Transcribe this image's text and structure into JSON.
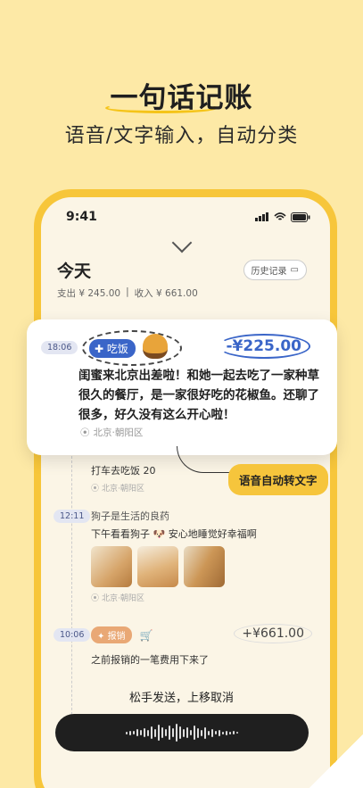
{
  "headline": {
    "title": "一句话记账",
    "subtitle": "语音/文字输入，自动分类"
  },
  "status_bar": {
    "time": "9:41"
  },
  "page": {
    "title": "今天",
    "history_button": "历史记录"
  },
  "totals": {
    "expense": "支出 ¥ 245.00",
    "separator": "|",
    "income": "收入 ¥ 661.00"
  },
  "card": {
    "time": "18:06",
    "tag": "吃饭",
    "amount": "-¥225.00",
    "text": "闺蜜来北京出差啦！和她一起去吃了一家种草很久的餐厅，是一家很好吃的花椒鱼。还聊了很多，好久没有这么开心啦！",
    "location": "北京·朝阳区"
  },
  "voice_tip": "语音自动转文字",
  "entries": [
    {
      "desc": "打车去吃饭 20",
      "location": "北京·朝阳区"
    },
    {
      "time": "12:11",
      "title": "狗子是生活的良药",
      "desc": "下午看看狗子 🐶 安心地睡觉好幸福啊",
      "location": "北京·朝阳区"
    },
    {
      "time": "10:06",
      "tag": "报销",
      "amount": "+¥661.00",
      "desc": "之前报销的一笔费用下来了"
    }
  ],
  "release_hint": "松手发送，上移取消",
  "colors": {
    "background": "#fde9a6",
    "accent_yellow": "#f6c53c",
    "tag_blue": "#3a65c8"
  }
}
